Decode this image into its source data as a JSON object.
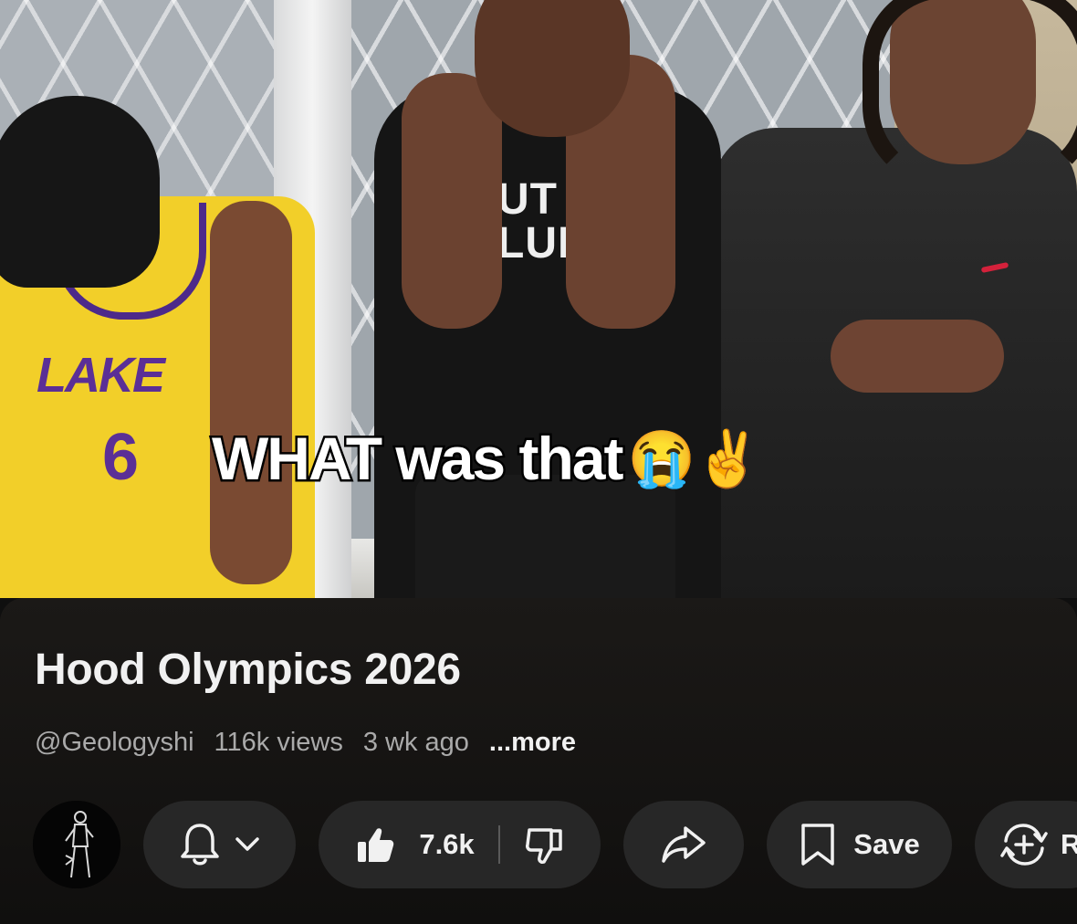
{
  "video": {
    "caption": "WHAT was that",
    "caption_emojis": "😭✌️",
    "jersey_letters": "LAKE",
    "jersey_number": "6",
    "shirt_print_line1": "UT A",
    "shirt_print_line2": "LUENC"
  },
  "info": {
    "title": "Hood Olympics 2026",
    "channel": "@Geologyshi",
    "views": "116k views",
    "age": "3 wk ago",
    "more_label": "...more"
  },
  "actions": {
    "avatar_icon": "channel-avatar",
    "subscribe_icon": "bell-icon",
    "subscribe_menu_icon": "chevron-down-icon",
    "like_icon": "thumbs-up-icon",
    "like_count": "7.6k",
    "dislike_icon": "thumbs-down-icon",
    "share_icon": "share-arrow-icon",
    "save_icon": "bookmark-icon",
    "save_label": "Save",
    "remix_icon": "remix-icon",
    "remix_label_partial": "R"
  },
  "colors": {
    "background": "#0f0f0f",
    "pill": "#272727",
    "text_primary": "#f1f1f1",
    "text_secondary": "#aaaaaa"
  }
}
